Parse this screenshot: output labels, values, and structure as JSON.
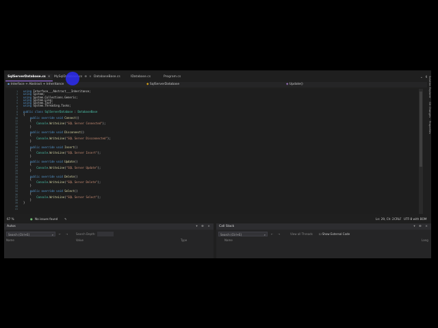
{
  "tabs": [
    {
      "label": "SqlServerDatabase.cs",
      "active": true
    },
    {
      "label": "MySqlDatabase.cs",
      "active": false
    },
    {
      "label": "DatabaseBase.cs",
      "active": false
    },
    {
      "label": "IDatabase.cs",
      "active": false
    },
    {
      "label": "Program.cs",
      "active": false
    }
  ],
  "navbar": {
    "project": "Interface + Abstract + Inheritance",
    "type": "SqlServerDatabase",
    "member": "Update()"
  },
  "code": {
    "usings": [
      "using Interface___Abstract___Inheritance;",
      "using System;",
      "using System.Collections.Generic;",
      "using System.Linq;",
      "using System.Text;",
      "using System.Threading.Tasks;"
    ],
    "class_decl": {
      "kw": "public class",
      "name": "SqlServerDatabase",
      "sep": " : ",
      "base": "DatabaseBase"
    },
    "methods": [
      {
        "sig": "Connect",
        "msg": "\"SQL Server Connected\""
      },
      {
        "sig": "Disconnect",
        "msg": "\"SQL Server Disconnected\""
      },
      {
        "sig": "Insert",
        "msg": "\"SQL Server Insert\""
      },
      {
        "sig": "Update",
        "msg": "\"SQL Server Update\""
      },
      {
        "sig": "Delete",
        "msg": "\"SQL Server Delete\""
      },
      {
        "sig": "Select",
        "msg": "\"SQL Server Select\""
      }
    ],
    "method_prefix": "public override void ",
    "call_prefix": "Console.WriteLine(",
    "line_numbers": [
      "1",
      "2",
      "3",
      "4",
      "5",
      "6",
      "7",
      "8",
      "9",
      "10",
      "11",
      "12",
      "13",
      "14",
      "15",
      "16",
      "17",
      "18",
      "19",
      "20",
      "21",
      "22",
      "23",
      "24",
      "25",
      "26",
      "27",
      "28",
      "29",
      "30",
      "31",
      "32",
      "33",
      "34",
      "35",
      "36",
      "37",
      "38",
      "39",
      "40",
      "41"
    ]
  },
  "status": {
    "zoom": "67 %",
    "issues": "No issues found",
    "position": "Ln: 29, Ch: 2",
    "line_ending": "CRLF",
    "encoding": "UTF-8 with BOM"
  },
  "right_rail": [
    "Solution Explorer",
    "Git Changes",
    "Properties"
  ],
  "autos_panel": {
    "title": "Autos",
    "search_placeholder": "Search (Ctrl+E)",
    "search_depth": "Search Depth:",
    "columns": [
      "Name",
      "Value",
      "Type"
    ]
  },
  "callstack_panel": {
    "title": "Call Stack",
    "search_placeholder": "Search (Ctrl+E)",
    "view_threads": "View all Threads",
    "show_external": "Show External Code",
    "columns": [
      "Name",
      "Lang"
    ]
  },
  "colors": {
    "accent": "#ad7cff",
    "keyword": "#569cd6",
    "type": "#4ec9b0",
    "string": "#ce9178",
    "method": "#dcdcaa"
  }
}
